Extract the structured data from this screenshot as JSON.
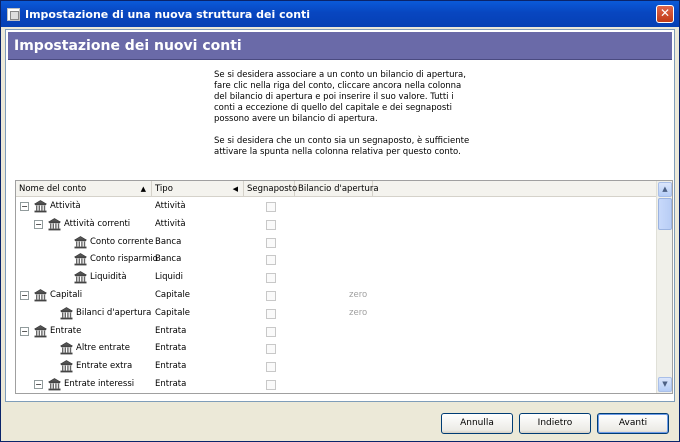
{
  "window": {
    "title": "Impostazione di una nuova struttura dei conti",
    "close_label": "✕"
  },
  "header": {
    "title": "Impostazione dei nuovi conti"
  },
  "info": {
    "para1": "Se si desidera associare a un conto un bilancio di apertura, fare clic nella riga del conto, cliccare ancora nella colonna del bilancio di apertura e poi inserire il suo valore. Tutti i conti a eccezione di quello del capitale e dei segnaposti possono avere un bilancio di apertura.",
    "para2": "Se si desidera che un conto sia un segnaposto, è sufficiente attivare la spunta nella colonna relativa per questo conto."
  },
  "grid": {
    "columns": {
      "name": "Nome del conto",
      "tipo": "Tipo",
      "segnaposto": "Segnaposto",
      "bilancio": "Bilancio d'apertura"
    },
    "rows": [
      {
        "name": "Attività",
        "tipo": "Attività",
        "level": 0,
        "expander": "−",
        "balance": ""
      },
      {
        "name": "Attività correnti",
        "tipo": "Attività",
        "level": 1,
        "expander": "−",
        "balance": ""
      },
      {
        "name": "Conto corrente",
        "tipo": "Banca",
        "level": 2,
        "expander": "",
        "balance": ""
      },
      {
        "name": "Conto risparmio",
        "tipo": "Banca",
        "level": 2,
        "expander": "",
        "balance": ""
      },
      {
        "name": "Liquidità",
        "tipo": "Liquidi",
        "level": 2,
        "expander": "",
        "balance": ""
      },
      {
        "name": "Capitali",
        "tipo": "Capitale",
        "level": 0,
        "expander": "−",
        "balance": "zero"
      },
      {
        "name": "Bilanci d'apertura",
        "tipo": "Capitale",
        "level": 1,
        "expander": "",
        "balance": "zero"
      },
      {
        "name": "Entrate",
        "tipo": "Entrata",
        "level": 0,
        "expander": "−",
        "balance": ""
      },
      {
        "name": "Altre entrate",
        "tipo": "Entrata",
        "level": 1,
        "expander": "",
        "balance": ""
      },
      {
        "name": "Entrate extra",
        "tipo": "Entrata",
        "level": 1,
        "expander": "",
        "balance": ""
      },
      {
        "name": "Entrate interessi",
        "tipo": "Entrata",
        "level": 1,
        "expander": "−",
        "balance": ""
      }
    ]
  },
  "buttons": {
    "cancel": "Annulla",
    "back": "Indietro",
    "forward": "Avanti"
  },
  "icons": {
    "account": "bank-icon",
    "sort_name": "▲",
    "sort_tipo": "◀",
    "scroll_up": "▲",
    "scroll_down": "▼"
  }
}
